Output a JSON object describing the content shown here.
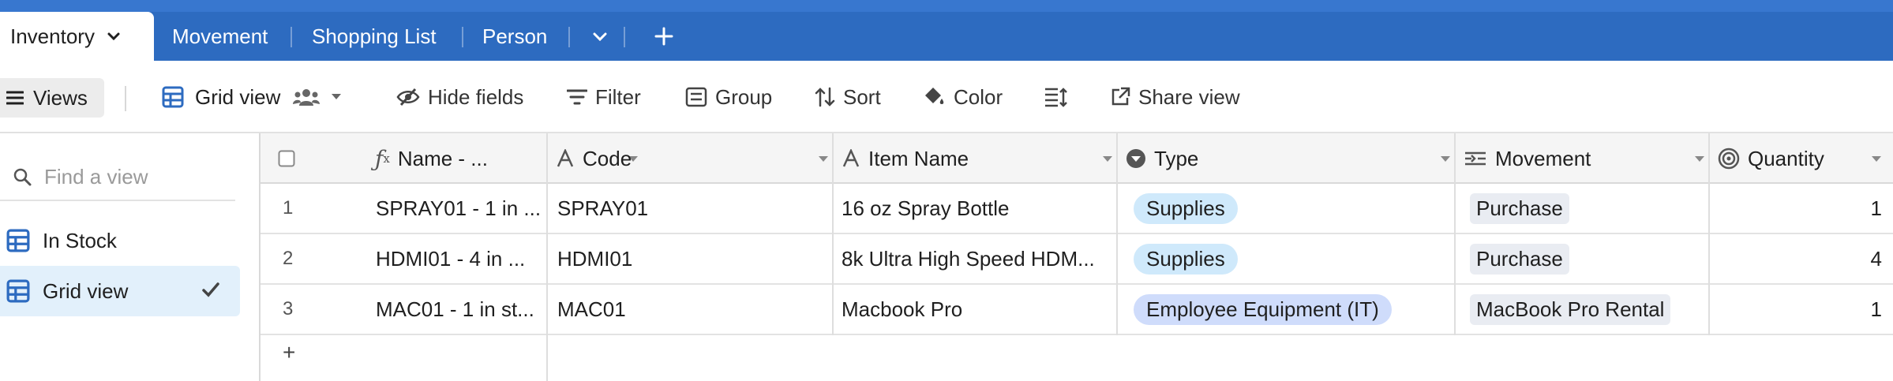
{
  "tabs": {
    "active": "Inventory",
    "items": [
      "Movement",
      "Shopping List",
      "Person"
    ]
  },
  "toolbar": {
    "views": "Views",
    "grid_view": "Grid view",
    "hide_fields": "Hide fields",
    "filter": "Filter",
    "group": "Group",
    "sort": "Sort",
    "color": "Color",
    "share_view": "Share view"
  },
  "sidebar": {
    "search_placeholder": "Find a view",
    "views": [
      "In Stock",
      "Grid view"
    ],
    "selected": "Grid view"
  },
  "grid": {
    "columns": [
      "Name - ...",
      "Code",
      "Item Name",
      "Type",
      "Movement",
      "Quantity"
    ],
    "rows": [
      {
        "num": "1",
        "name": "SPRAY01 - 1 in ...",
        "code": "SPRAY01",
        "item": "16 oz Spray Bottle",
        "type": "Supplies",
        "movement": "Purchase",
        "qty": "1"
      },
      {
        "num": "2",
        "name": "HDMI01 - 4 in ...",
        "code": "HDMI01",
        "item": "8k Ultra High Speed HDM...",
        "type": "Supplies",
        "movement": "Purchase",
        "qty": "4"
      },
      {
        "num": "3",
        "name": "MAC01 - 1 in st...",
        "code": "MAC01",
        "item": "Macbook Pro",
        "type": "Employee Equipment (IT)",
        "movement": "MacBook Pro Rental",
        "qty": "1"
      }
    ],
    "add_row": "+"
  },
  "colors": {
    "tabbar": "#2d6bc0",
    "accent": "#2d6bc0",
    "pill_supplies": "#cfe9fb",
    "pill_equipment": "#cfdcfb",
    "selected_view_bg": "#e2f0fb"
  }
}
